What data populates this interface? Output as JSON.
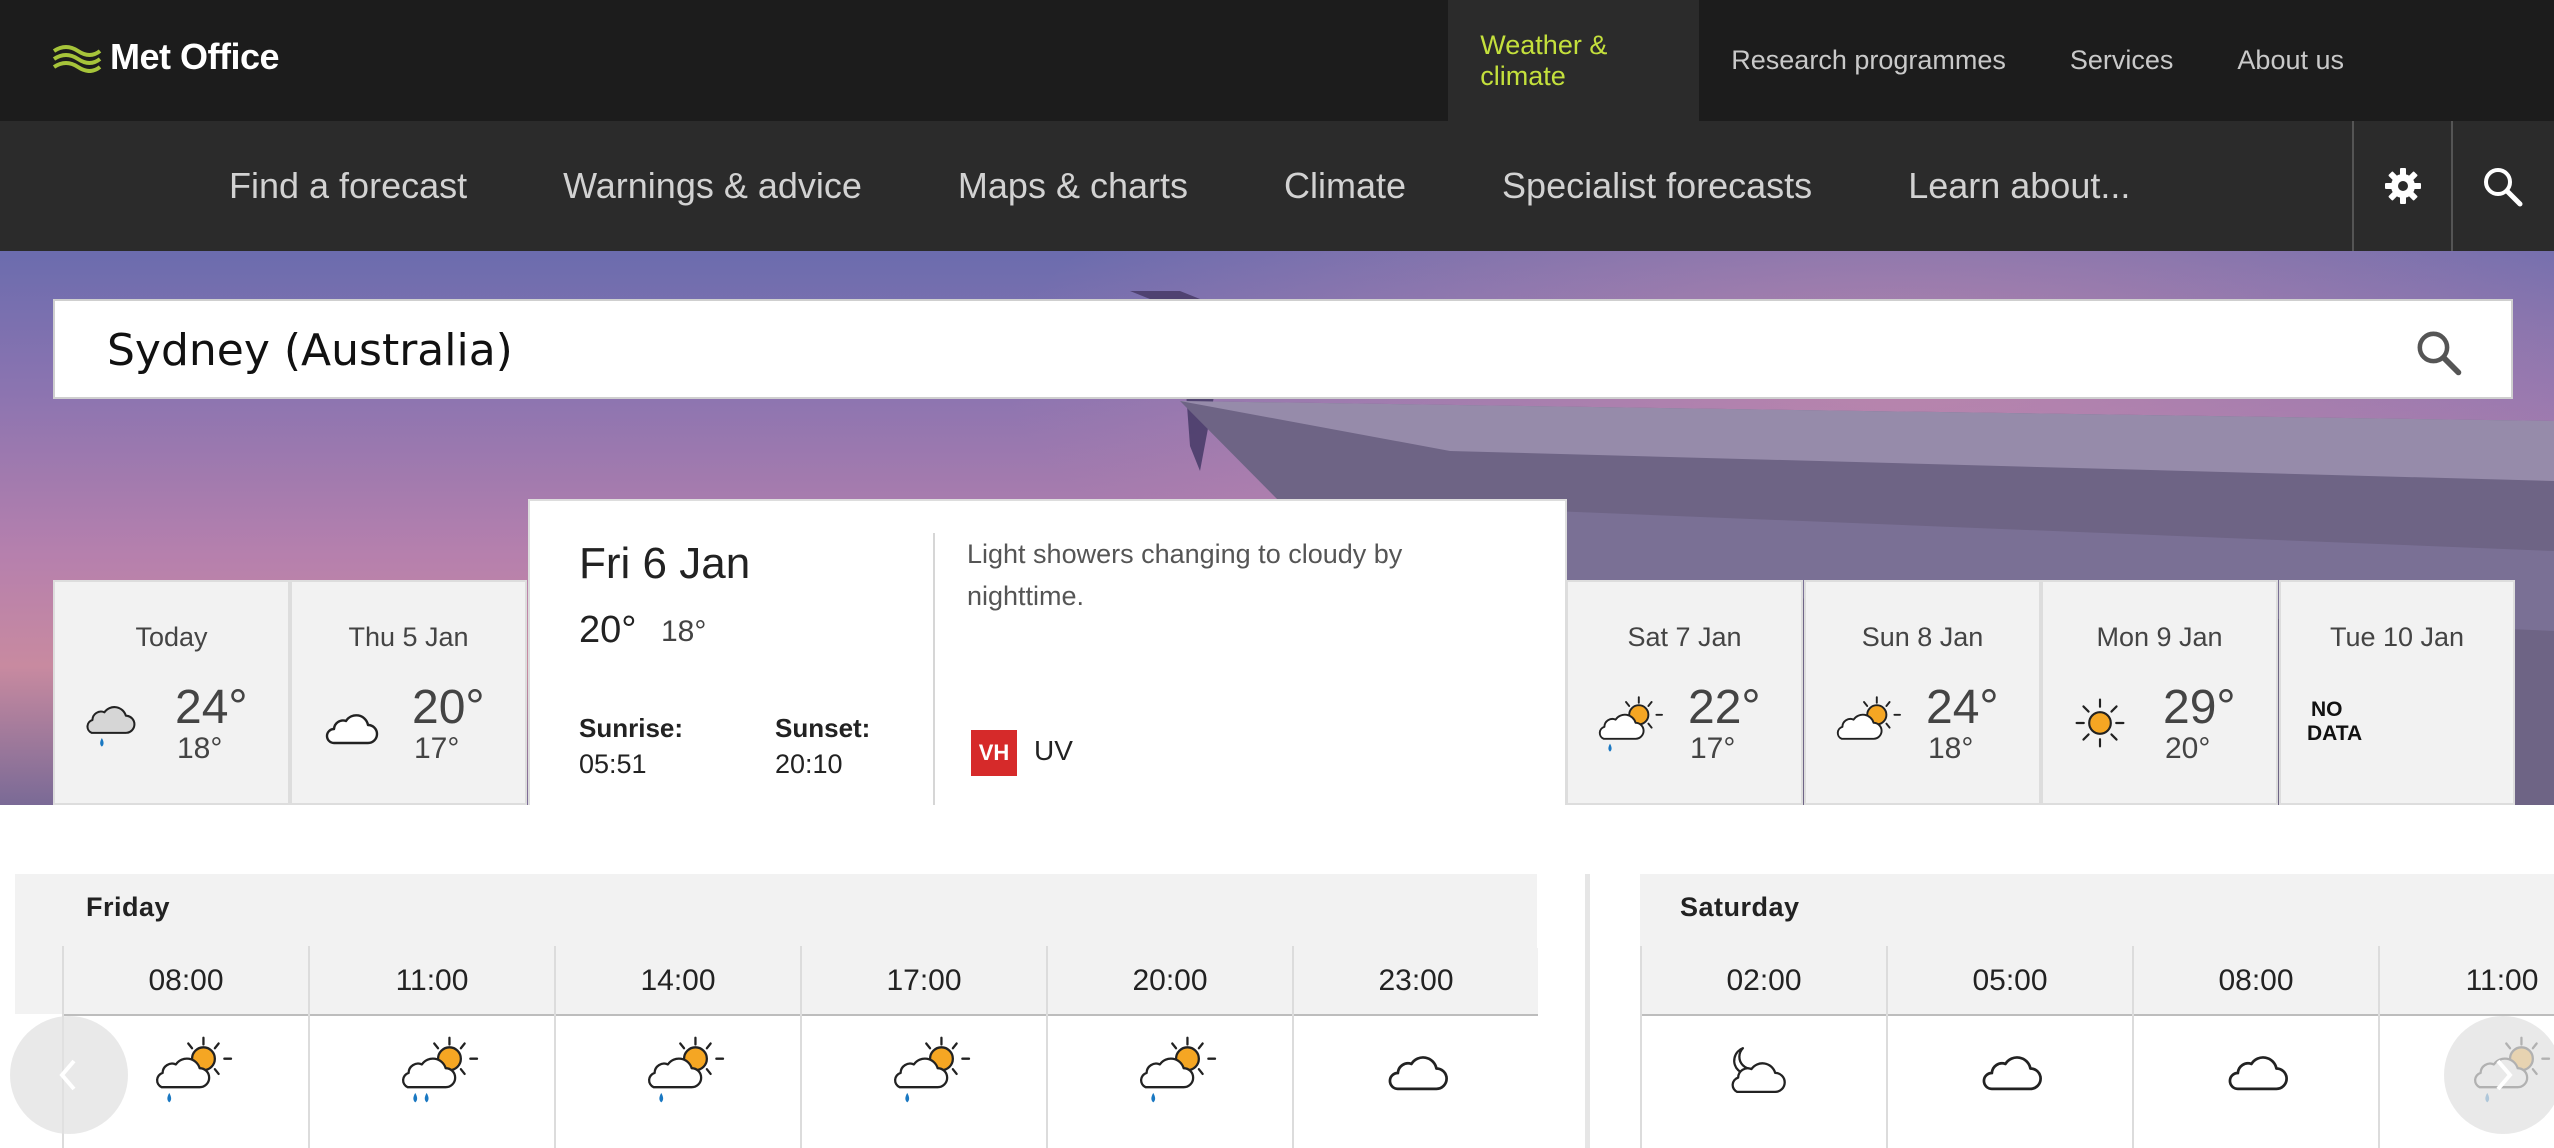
{
  "brand": {
    "name": "Met Office"
  },
  "topnav": [
    {
      "label": "Weather & climate",
      "active": true
    },
    {
      "label": "Research programmes"
    },
    {
      "label": "Services"
    },
    {
      "label": "About us"
    }
  ],
  "subnav": [
    {
      "label": "Find a forecast"
    },
    {
      "label": "Warnings & advice"
    },
    {
      "label": "Maps & charts"
    },
    {
      "label": "Climate"
    },
    {
      "label": "Specialist forecasts"
    },
    {
      "label": "Learn about..."
    }
  ],
  "icons": {
    "settings": "gear-icon",
    "search": "search-icon"
  },
  "search": {
    "value": "Sydney (Australia)"
  },
  "days": [
    {
      "name": "Today",
      "high": "24°",
      "low": "18°",
      "icon": "rain-cloud-icon"
    },
    {
      "name": "Thu 5 Jan",
      "high": "20°",
      "low": "17°",
      "icon": "cloud-icon"
    },
    {
      "name": "Sat 7 Jan",
      "high": "22°",
      "low": "17°",
      "icon": "sun-cloud-rain-icon"
    },
    {
      "name": "Sun 8 Jan",
      "high": "24°",
      "low": "18°",
      "icon": "sun-cloud-icon"
    },
    {
      "name": "Mon 9 Jan",
      "high": "29°",
      "low": "20°",
      "icon": "sun-icon"
    },
    {
      "name": "Tue 10 Jan",
      "nodata_line1": "NO",
      "nodata_line2": "DATA"
    }
  ],
  "selected_day": {
    "date": "Fri 6 Jan",
    "high": "20°",
    "low": "18°",
    "sunrise_label": "Sunrise:",
    "sunrise": "05:51",
    "sunset_label": "Sunset:",
    "sunset": "20:10",
    "description": "Light showers changing to cloudy by nighttime.",
    "uv_badge": "VH",
    "uv_label": "UV",
    "colors": {
      "uv_very_high": "#d62a2a"
    }
  },
  "hourly": {
    "days": [
      {
        "label": "Friday",
        "hours": [
          {
            "time": "08:00",
            "icon": "sun-cloud-rain-icon"
          },
          {
            "time": "11:00",
            "icon": "sun-cloud-heavy-rain-icon"
          },
          {
            "time": "14:00",
            "icon": "sun-cloud-rain-icon"
          },
          {
            "time": "17:00",
            "icon": "sun-cloud-rain-icon"
          },
          {
            "time": "20:00",
            "icon": "sun-cloud-rain-icon"
          },
          {
            "time": "23:00",
            "icon": "cloud-icon"
          }
        ]
      },
      {
        "label": "Saturday",
        "hours": [
          {
            "time": "02:00",
            "icon": "moon-cloud-icon"
          },
          {
            "time": "05:00",
            "icon": "cloud-icon"
          },
          {
            "time": "08:00",
            "icon": "cloud-icon"
          },
          {
            "time": "11:00",
            "icon": "sun-cloud-rain-icon"
          }
        ]
      }
    ]
  },
  "colors": {
    "accent": "#c4e03c",
    "topbar": "#1c1c1c",
    "subnav": "#2b2b2b",
    "sun": "#f5a623",
    "rain": "#1a78c2"
  }
}
